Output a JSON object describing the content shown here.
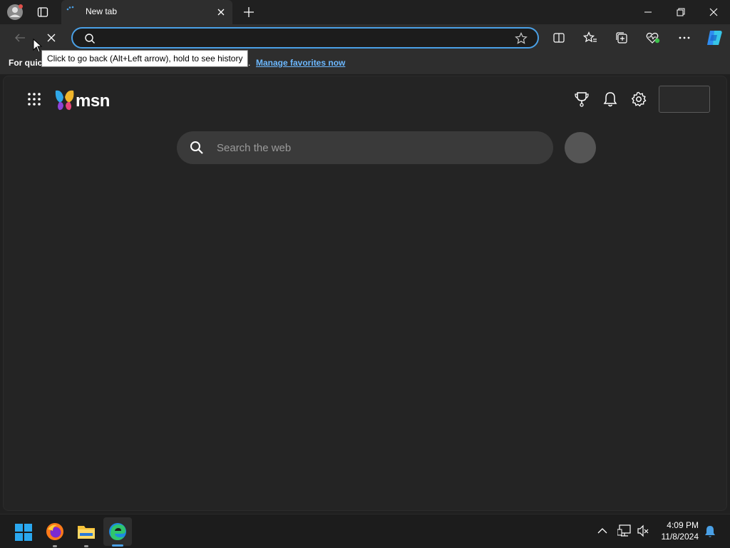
{
  "tab": {
    "title": "New tab"
  },
  "addressbar": {
    "value": "",
    "placeholder": ""
  },
  "tooltip": {
    "text": "Click to go back (Alt+Left arrow), hold to see history"
  },
  "favorites_bar": {
    "prompt": "For quic",
    "period": ".",
    "link": "Manage favorites now"
  },
  "msn": {
    "logo_text": "msn",
    "search_placeholder": "Search the web"
  },
  "taskbar": {
    "time": "4:09 PM",
    "date": "11/8/2024"
  },
  "colors": {
    "accent": "#4aa0e6",
    "link": "#6cb8ff",
    "background": "#202020",
    "content": "#242424"
  }
}
